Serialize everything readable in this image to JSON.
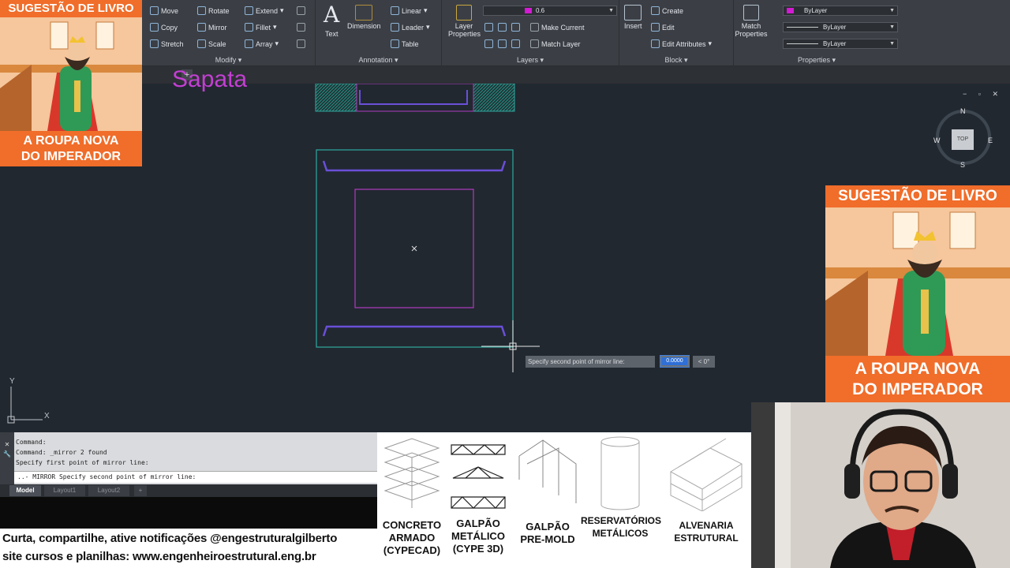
{
  "ribbon": {
    "modify": {
      "title": "Modify",
      "items": [
        "Move",
        "Rotate",
        "Extend",
        "Copy",
        "Mirror",
        "Fillet",
        "Stretch",
        "Scale",
        "Array"
      ]
    },
    "annotation": {
      "title": "Annotation",
      "text_label": "Text",
      "dimension_label": "Dimension",
      "linear": "Linear",
      "leader": "Leader",
      "table": "Table"
    },
    "layers": {
      "title": "Layers",
      "layer_properties": "Layer Properties",
      "current_layer": "0.6",
      "make_current": "Make Current",
      "match_layer": "Match Layer"
    },
    "block": {
      "title": "Block",
      "insert": "Insert",
      "create": "Create",
      "edit": "Edit",
      "edit_attributes": "Edit Attributes"
    },
    "properties": {
      "title": "Properties",
      "match_properties": "Match Properties",
      "color": "ByLayer",
      "linetype": "ByLayer",
      "lineweight": "ByLayer"
    }
  },
  "drawing": {
    "title_text": "Sapata",
    "viewcube": {
      "top": "TOP",
      "n": "N",
      "s": "S",
      "e": "E",
      "w": "W"
    },
    "ucs": {
      "x": "X",
      "y": "Y"
    },
    "dyn_input": {
      "prompt": "Specify second point of mirror line:",
      "value": "0.0000",
      "angle": "< 0°"
    }
  },
  "command_line": {
    "lines": [
      "Command:",
      "Command: _mirror 2 found",
      "Specify first point of mirror line:"
    ],
    "prompt": "..- MIRROR Specify second point of mirror line:"
  },
  "layout_tabs": [
    "Model",
    "Layout1",
    "Layout2"
  ],
  "footer": {
    "line1": "Curta, compartilhe, ative notificações @engestruturalgilberto",
    "line2": "site cursos e planilhas: www.engenheiroestrutural.eng.br"
  },
  "courses": [
    {
      "line1": "CONCRETO",
      "line2": "ARMADO",
      "line3": "(CYPECAD)"
    },
    {
      "line1": "GALPÃO",
      "line2": "METÁLICO",
      "line3": "(CYPE 3D)"
    },
    {
      "line1": "GALPÃO",
      "line2": "PRE-MOLD",
      "line3": ""
    },
    {
      "line1": "RESERVATÓRIOS",
      "line2": "METÁLICOS",
      "line3": ""
    },
    {
      "line1": "ALVENARIA",
      "line2": "ESTRUTURAL",
      "line3": ""
    }
  ],
  "ad_small": {
    "header": "SUGESTÃO DE LIVRO",
    "footer1": "A ROUPA NOVA",
    "footer2": "DO IMPERADOR"
  },
  "ad_large": {
    "header": "SUGESTÃO DE LIVRO",
    "footer1": "A ROUPA NOVA",
    "footer2": "DO IMPERADOR"
  },
  "colors": {
    "canvas": "#212830",
    "footing_outline": "#2fa9a0",
    "column_outline": "#b03bc0",
    "rebar": "#6a4fd8",
    "title_magenta": "#c33fd2",
    "ad_orange": "#f06d2a"
  }
}
